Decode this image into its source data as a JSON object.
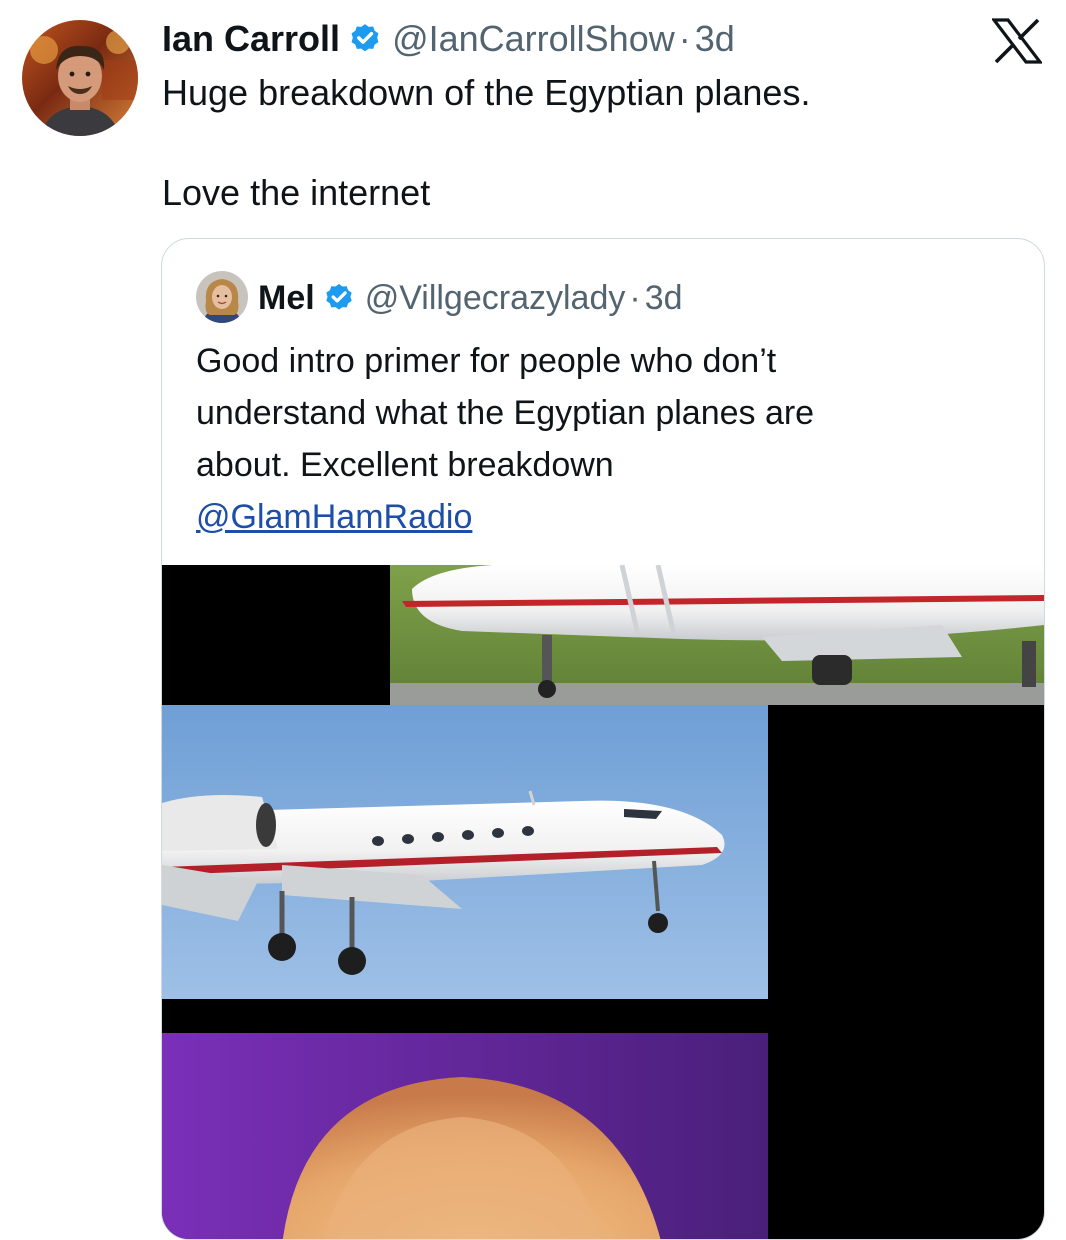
{
  "tweet": {
    "author_name": "Ian Carroll",
    "handle": "@IanCarrollShow",
    "separator": "·",
    "time": "3d",
    "text_lines": [
      "Huge breakdown of the Egyptian planes.",
      "Love the internet"
    ]
  },
  "quoted_tweet": {
    "author_name": "Mel",
    "handle": "@Villgecrazylady",
    "separator": "·",
    "time": "3d",
    "text_lines": [
      "Good intro primer for people who don’t",
      "understand what the Egyptian planes are",
      "about. Excellent breakdown"
    ],
    "mention": "@GlamHamRadio"
  },
  "icons": {
    "verified": "verified-badge-icon",
    "brand": "x-logo-icon"
  },
  "colors": {
    "text": "#0f1419",
    "muted": "#536471",
    "verified": "#1d9bf0",
    "link": "#1d4ea8",
    "border": "#cfd9de"
  }
}
